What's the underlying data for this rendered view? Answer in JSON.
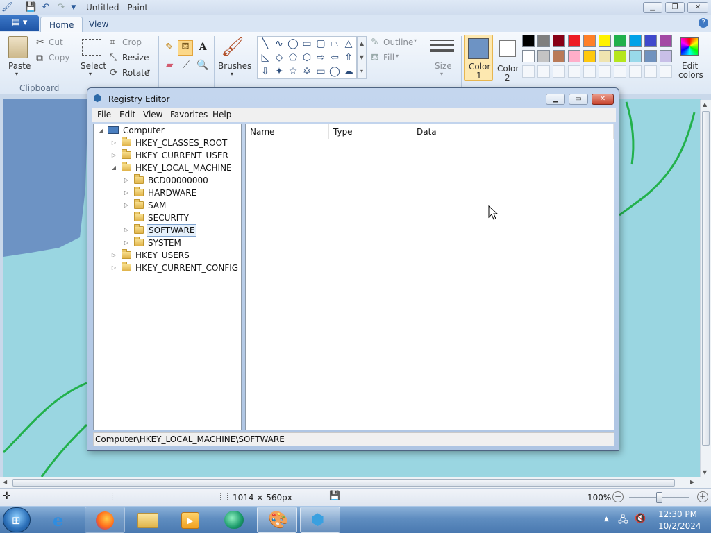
{
  "paint": {
    "title": "Untitled - Paint",
    "file_menu_label": "▤ ▾",
    "tabs": [
      "Home",
      "View"
    ],
    "clipboard": {
      "paste": "Paste",
      "cut": "Cut",
      "copy": "Copy",
      "group": "Clipboard"
    },
    "image": {
      "select": "Select",
      "crop": "Crop",
      "resize": "Resize",
      "rotate": "Rotate"
    },
    "brushes": "Brushes",
    "outline": "Outline",
    "fill": "Fill",
    "size": "Size",
    "color1": {
      "label": "Color",
      "num": "1",
      "value": "#6d93c4"
    },
    "color2": {
      "label": "Color",
      "num": "2",
      "value": "#ffffff"
    },
    "edit_colors": {
      "l1": "Edit",
      "l2": "colors"
    },
    "palette_row1": [
      "#000000",
      "#7f7f7f",
      "#880015",
      "#ed1c24",
      "#ff7f27",
      "#fff200",
      "#22b14c",
      "#00a2e8",
      "#3f48cc",
      "#a349a4"
    ],
    "palette_row2": [
      "#ffffff",
      "#c3c3c3",
      "#b97a57",
      "#ffaec9",
      "#ffc90e",
      "#efe4b0",
      "#b5e61d",
      "#99d9ea",
      "#7092be",
      "#c8bfe7"
    ],
    "status": {
      "dimensions": "1014 × 560px",
      "zoom": "100%"
    },
    "canvas_colors": {
      "background": "#9ad6e1",
      "shape": "#6d93c4",
      "stroke": "#22b14c"
    }
  },
  "regedit": {
    "title": "Registry Editor",
    "menu": [
      "File",
      "Edit",
      "View",
      "Favorites",
      "Help"
    ],
    "tree": {
      "root": "Computer",
      "hives": [
        "HKEY_CLASSES_ROOT",
        "HKEY_CURRENT_USER",
        "HKEY_LOCAL_MACHINE"
      ],
      "hklm_children": [
        "BCD00000000",
        "HARDWARE",
        "SAM",
        "SECURITY",
        "SOFTWARE",
        "SYSTEM"
      ],
      "hives_after": [
        "HKEY_USERS",
        "HKEY_CURRENT_CONFIG"
      ],
      "selected": "SOFTWARE"
    },
    "columns": [
      "Name",
      "Type",
      "Data"
    ],
    "status_path": "Computer\\HKEY_LOCAL_MACHINE\\SOFTWARE"
  },
  "taskbar": {
    "time": "12:30 PM",
    "date": "10/2/2024"
  }
}
